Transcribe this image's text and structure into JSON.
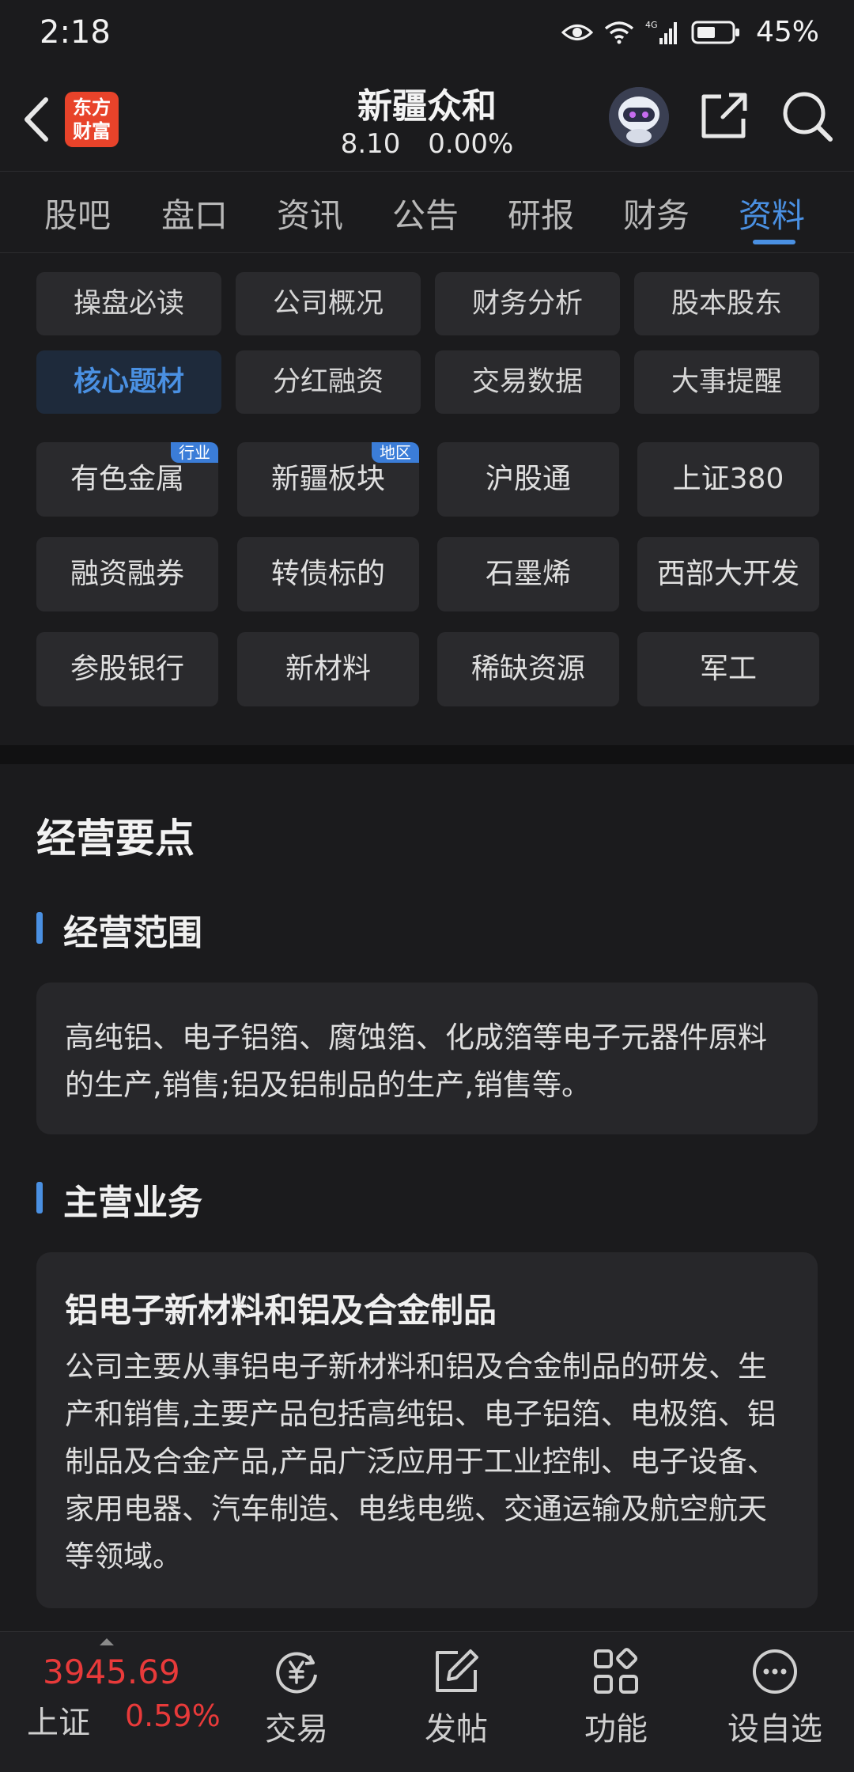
{
  "status": {
    "time": "2:18",
    "network": "4G",
    "battery": "45%"
  },
  "header": {
    "logo_text_1": "东方",
    "logo_text_2": "财富",
    "stock_name": "新疆众和",
    "price": "8.10",
    "change_pct": "0.00%"
  },
  "tabs": [
    {
      "label": "股吧"
    },
    {
      "label": "盘口"
    },
    {
      "label": "资讯"
    },
    {
      "label": "公告"
    },
    {
      "label": "研报"
    },
    {
      "label": "财务"
    },
    {
      "label": "资料",
      "active": true
    }
  ],
  "categories": [
    {
      "label": "操盘必读"
    },
    {
      "label": "公司概况"
    },
    {
      "label": "财务分析"
    },
    {
      "label": "股本股东"
    },
    {
      "label": "核心题材",
      "active": true
    },
    {
      "label": "分红融资"
    },
    {
      "label": "交易数据"
    },
    {
      "label": "大事提醒"
    }
  ],
  "tags": [
    {
      "label": "有色金属",
      "badge": "行业"
    },
    {
      "label": "新疆板块",
      "badge": "地区"
    },
    {
      "label": "沪股通"
    },
    {
      "label": "上证380"
    },
    {
      "label": "融资融券"
    },
    {
      "label": "转债标的"
    },
    {
      "label": "石墨烯"
    },
    {
      "label": "西部大开发"
    },
    {
      "label": "参股银行"
    },
    {
      "label": "新材料"
    },
    {
      "label": "稀缺资源"
    },
    {
      "label": "军工"
    }
  ],
  "content": {
    "title": "经营要点",
    "scope": {
      "title": "经营范围",
      "text": "高纯铝、电子铝箔、腐蚀箔、化成箔等电子元器件原料的生产,销售;铝及铝制品的生产,销售等。"
    },
    "business": {
      "title": "主营业务",
      "heading": "铝电子新材料和铝及合金制品",
      "text": "公司主要从事铝电子新材料和铝及合金制品的研发、生产和销售,主要产品包括高纯铝、电子铝箔、电极箔、铝制品及合金产品,产品广泛应用于工业控制、电子设备、家用电器、汽车制造、电线电缆、交通运输及航空航天等领域。"
    }
  },
  "bottom": {
    "index_value": "3945.69",
    "index_name": "上证",
    "index_pct": "0.59%",
    "nav": [
      {
        "label": "交易"
      },
      {
        "label": "发帖"
      },
      {
        "label": "功能"
      },
      {
        "label": "设自选"
      }
    ]
  },
  "colors": {
    "accent": "#4a90e2",
    "up": "#e83a3a",
    "background": "#1b1b1d",
    "card": "#27272a"
  }
}
